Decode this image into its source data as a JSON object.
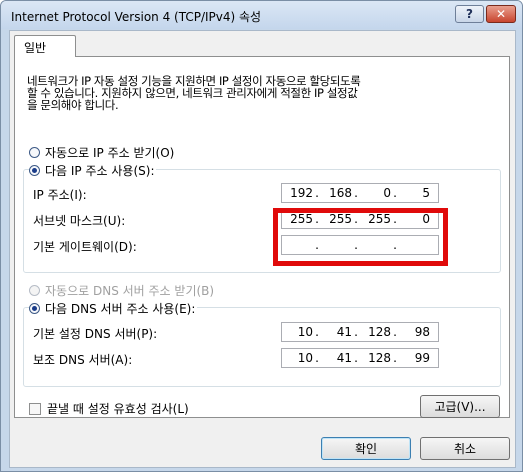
{
  "window": {
    "title": "Internet Protocol Version 4 (TCP/IPv4) 속성",
    "help_label": "?",
    "close_label": "✕"
  },
  "tabs": [
    {
      "label": "일반",
      "selected": true
    }
  ],
  "description": {
    "lines": [
      "네트워크가 IP 자동 설정 기능을 지원하면 IP 설정이 자동으로 할당되도록",
      "할 수 있습니다. 지원하지 않으면, 네트워크 관리자에게 적절한 IP 설정값",
      "을 문의해야 합니다."
    ]
  },
  "ip_options": {
    "auto_label": "자동으로 IP 주소 받기(O)",
    "auto_selected": false,
    "manual_label": "다음 IP 주소 사용(S):",
    "manual_selected": true
  },
  "ip_fields": {
    "ip_address": {
      "label": "IP 주소(I):",
      "octets": [
        "192",
        "168",
        "0",
        "5"
      ]
    },
    "subnet_mask": {
      "label": "서브넷 마스크(U):",
      "octets": [
        "255",
        "255",
        "255",
        "0"
      ]
    },
    "gateway": {
      "label": "기본 게이트웨이(D):",
      "octets": [
        "",
        "",
        "",
        ""
      ]
    }
  },
  "dns_options": {
    "auto_label": "자동으로 DNS 서버 주소 받기(B)",
    "auto_enabled": false,
    "manual_label": "다음 DNS 서버 주소 사용(E):",
    "manual_selected": true
  },
  "dns_fields": {
    "preferred": {
      "label": "기본 설정 DNS 서버(P):",
      "octets": [
        "10",
        "41",
        "128",
        "98"
      ]
    },
    "alternate": {
      "label": "보조 DNS 서버(A):",
      "octets": [
        "10",
        "41",
        "128",
        "99"
      ]
    }
  },
  "validate": {
    "label": "끝낼 때 설정 유효성 검사(L)",
    "checked": false
  },
  "buttons": {
    "advanced": "고급(V)...",
    "ok": "확인",
    "cancel": "취소"
  },
  "colors": {
    "highlight": "#e00a0a",
    "selected_radio": "#1a3c8a"
  }
}
